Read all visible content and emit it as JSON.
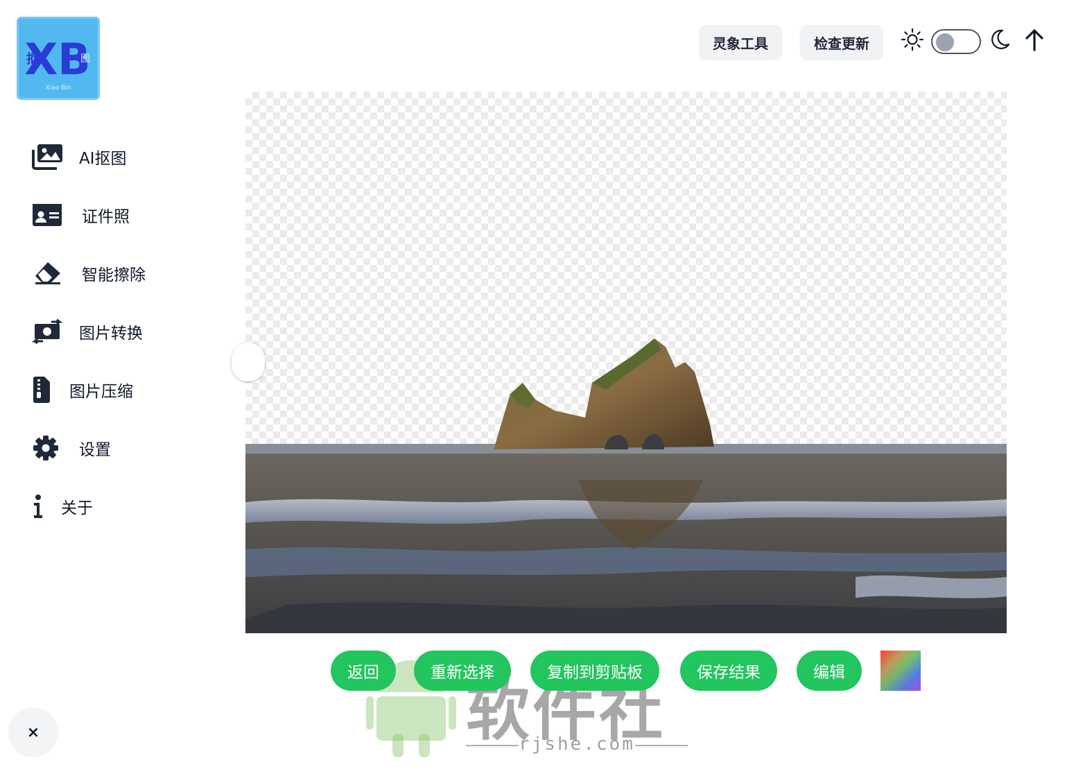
{
  "logo": {
    "main": "XB",
    "left_text": "抠",
    "right_text": "图",
    "sub_text": "Xiao Bin"
  },
  "sidebar": {
    "items": [
      {
        "label": "AI抠图",
        "icon": "images-icon"
      },
      {
        "label": "证件照",
        "icon": "id-card-icon"
      },
      {
        "label": "智能擦除",
        "icon": "eraser-icon"
      },
      {
        "label": "图片转换",
        "icon": "money-bill-transfer-icon"
      },
      {
        "label": "图片压缩",
        "icon": "file-zipper-icon"
      },
      {
        "label": "设置",
        "icon": "gear-icon"
      },
      {
        "label": "关于",
        "icon": "info-icon"
      }
    ]
  },
  "header": {
    "tool_button": "灵象工具",
    "update_button": "检查更新",
    "theme": {
      "light_icon": "sun-icon",
      "dark_icon": "moon-icon",
      "dark_mode": false
    },
    "upload_icon": "arrow-up-icon"
  },
  "actions": {
    "back": "返回",
    "reselect": "重新选择",
    "copy": "复制到剪贴板",
    "save": "保存结果",
    "edit": "编辑"
  },
  "close_label": "×",
  "watermark": {
    "text": "软件社",
    "url": "rjshe.com"
  },
  "colors": {
    "accent": "#22c55e",
    "nav_icon": "#1f2937",
    "toggle_knob": "#9ca3af"
  }
}
